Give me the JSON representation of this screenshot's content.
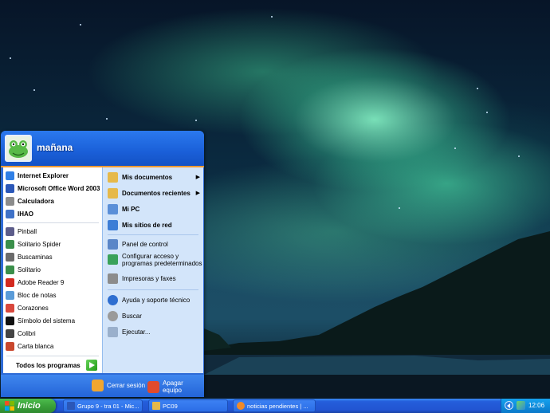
{
  "user": {
    "name": "mañana"
  },
  "pinned": [
    {
      "label": "Internet Explorer",
      "icon": "internet-explorer-icon",
      "color": "#2f7fe6"
    },
    {
      "label": "Microsoft Office Word 2003",
      "icon": "word-icon",
      "color": "#2b57b8"
    },
    {
      "label": "Calculadora",
      "icon": "calculator-icon",
      "color": "#8c8c8c"
    },
    {
      "label": "IHAO",
      "icon": "ihao-icon",
      "color": "#3f72c8"
    }
  ],
  "recent": [
    {
      "label": "Pinball",
      "icon": "pinball-icon",
      "color": "#5c5c8a"
    },
    {
      "label": "Solitario Spider",
      "icon": "spider-solitaire-icon",
      "color": "#3a8f4a"
    },
    {
      "label": "Buscaminas",
      "icon": "minesweeper-icon",
      "color": "#6b6b6b"
    },
    {
      "label": "Solitario",
      "icon": "solitaire-icon",
      "color": "#3a8f4a"
    },
    {
      "label": "Adobe Reader 9",
      "icon": "adobe-reader-icon",
      "color": "#d32a1f"
    },
    {
      "label": "Bloc de notas",
      "icon": "notepad-icon",
      "color": "#5a9bd8"
    },
    {
      "label": "Corazones",
      "icon": "hearts-icon",
      "color": "#d8473c"
    },
    {
      "label": "Símbolo del sistema",
      "icon": "command-prompt-icon",
      "color": "#111111"
    },
    {
      "label": "Colibri",
      "icon": "colibri-icon",
      "color": "#444444"
    },
    {
      "label": "Carta blanca",
      "icon": "freecell-icon",
      "color": "#c9472d"
    }
  ],
  "all_programs_label": "Todos los programas",
  "places": [
    {
      "label": "Mis documentos",
      "icon": "my-documents-icon",
      "color": "#e6b94a",
      "arrow": true
    },
    {
      "label": "Documentos recientes",
      "icon": "recent-documents-icon",
      "color": "#e6b94a",
      "arrow": true
    },
    {
      "label": "Mi PC",
      "icon": "my-computer-icon",
      "color": "#5a8fd8"
    },
    {
      "label": "Mis sitios de red",
      "icon": "network-places-icon",
      "color": "#3d7ed6"
    }
  ],
  "system": [
    {
      "label": "Panel de control",
      "icon": "control-panel-icon",
      "color": "#5a86c8"
    },
    {
      "label_line1": "Configurar acceso y",
      "label_line2": "programas predeterminados",
      "icon": "default-programs-icon",
      "color": "#3aa25a"
    },
    {
      "label": "Impresoras y faxes",
      "icon": "printers-icon",
      "color": "#8c8c8c"
    }
  ],
  "help": [
    {
      "label": "Ayuda y soporte técnico",
      "icon": "help-icon",
      "color": "#2e6ed0"
    },
    {
      "label": "Buscar",
      "icon": "search-icon",
      "color": "#9a9a9a"
    },
    {
      "label": "Ejecutar...",
      "icon": "run-icon",
      "color": "#9ab0cc"
    }
  ],
  "footer": {
    "logoff_label": "Cerrar sesión",
    "shutdown_label": "Apagar equipo"
  },
  "taskbar": {
    "start_label": "Inicio",
    "tasks": [
      {
        "label": "Grupo 9 - tra 01 - Mic...",
        "icon": "word-icon"
      },
      {
        "label": "PC09",
        "icon": "folder-icon"
      },
      {
        "label": "noticias pendientes | ...",
        "icon": "browser-icon"
      }
    ],
    "clock": "12:06"
  }
}
